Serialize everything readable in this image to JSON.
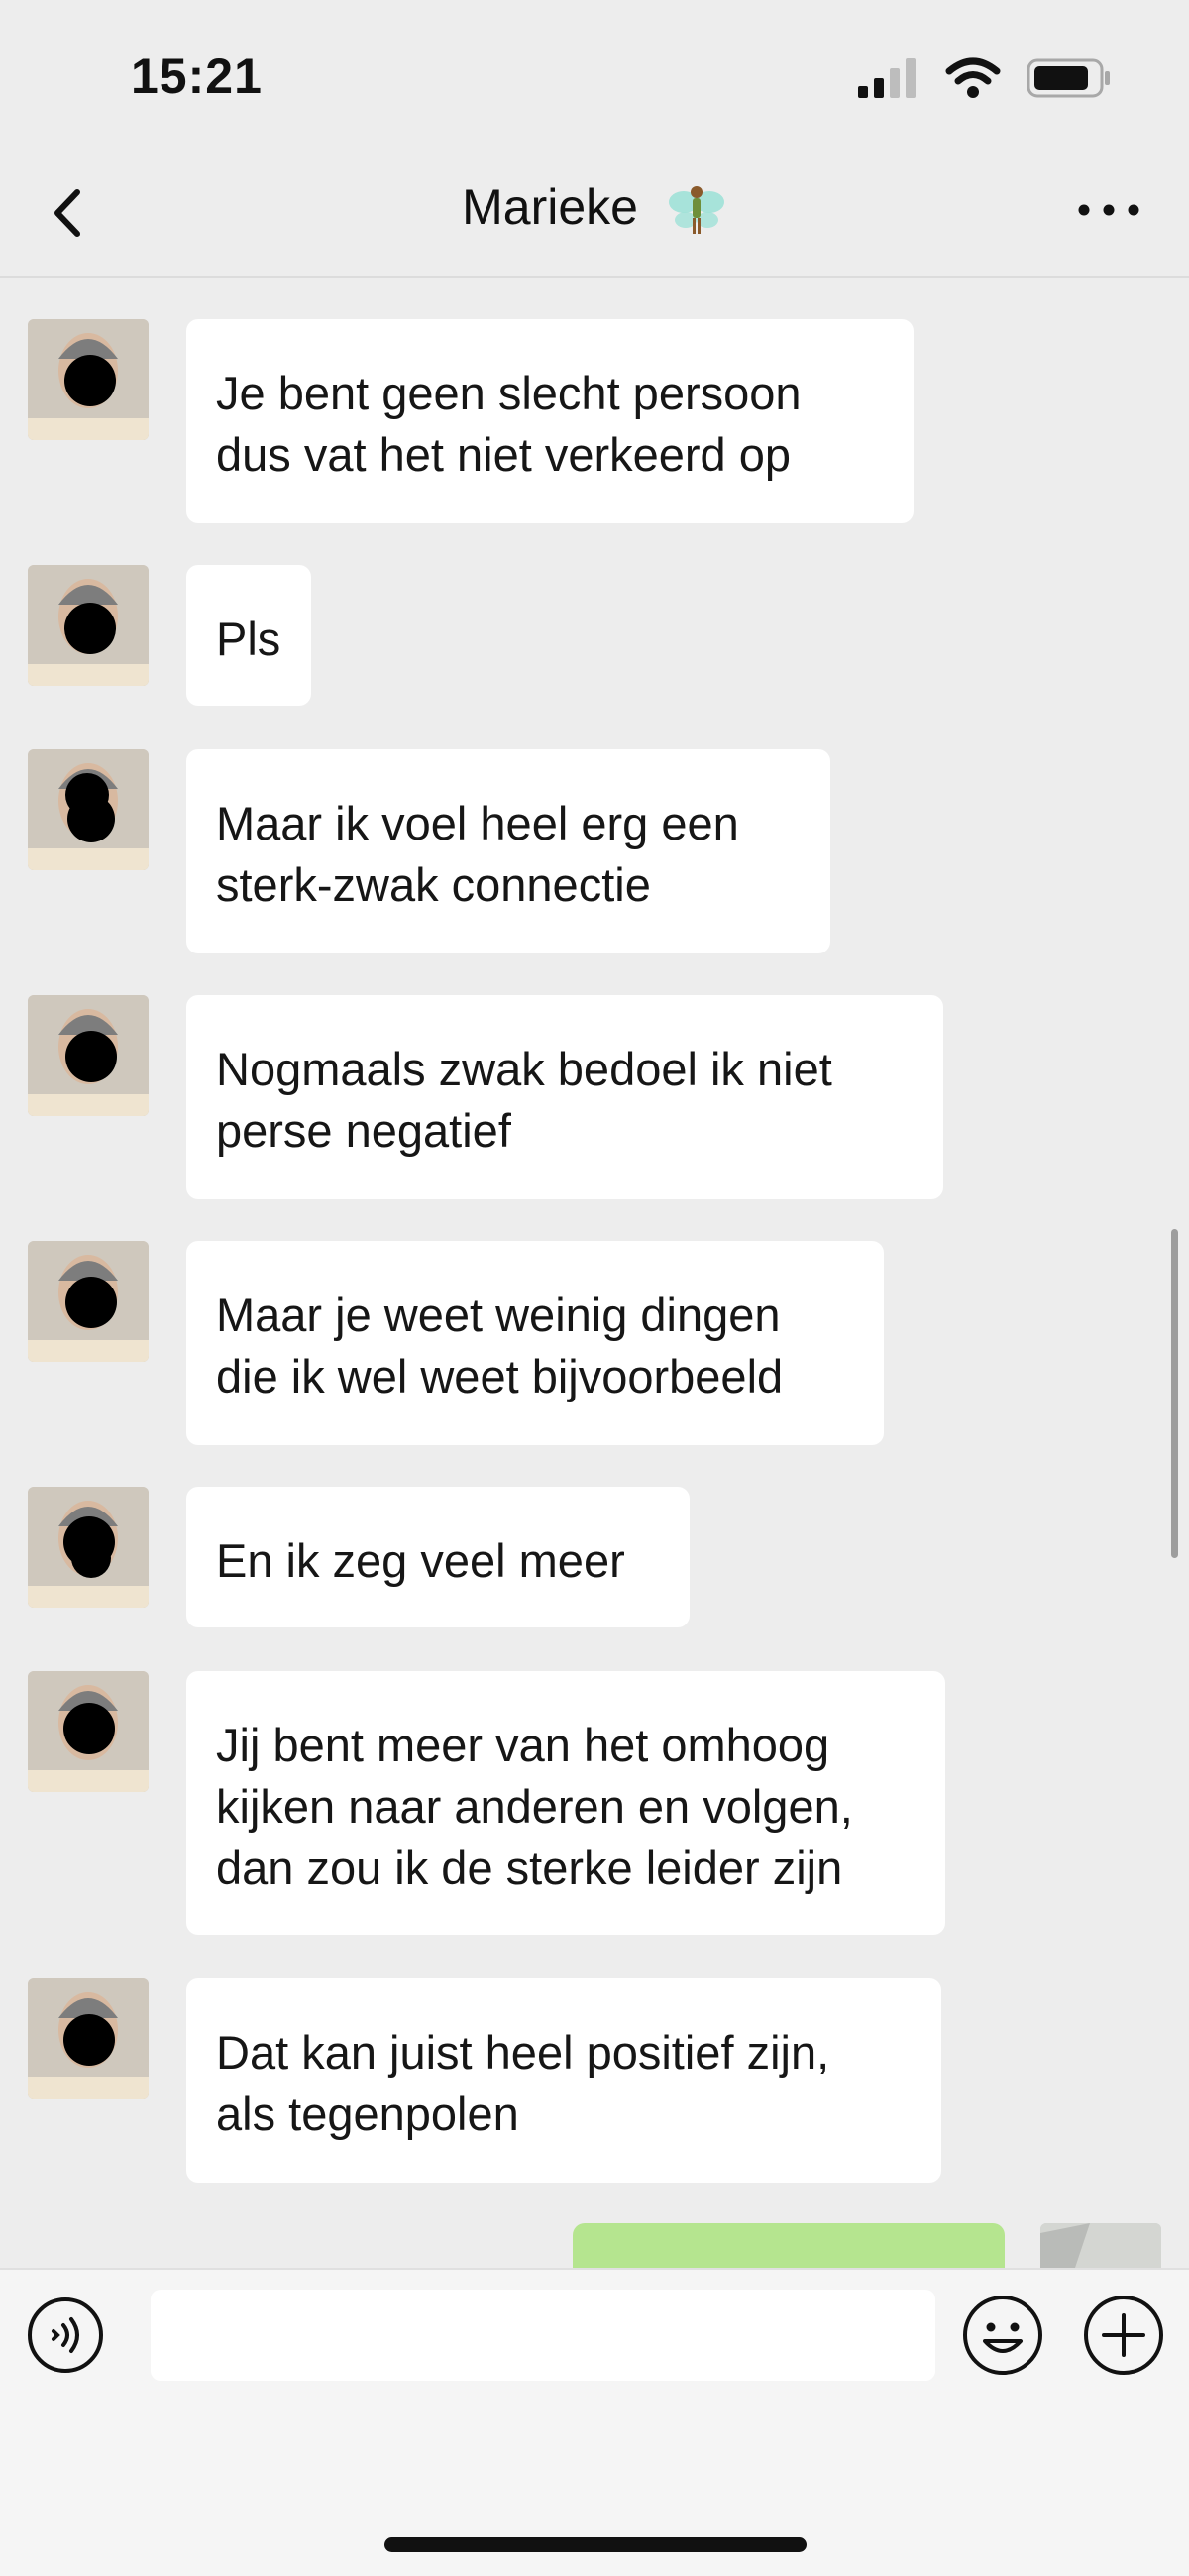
{
  "status": {
    "time": "15:21"
  },
  "header": {
    "title": "Marieke",
    "title_emoji": "fairy-icon"
  },
  "messages": [
    {
      "text": "Je bent geen slecht persoon\ndus vat het niet verkeerd op",
      "direction": "incoming"
    },
    {
      "text": "Pls",
      "direction": "incoming"
    },
    {
      "text": "Maar ik voel heel erg een\nsterk-zwak connectie",
      "direction": "incoming"
    },
    {
      "text": "Nogmaals zwak bedoel ik niet\nperse negatief",
      "direction": "incoming"
    },
    {
      "text": "Maar je weet weinig dingen\ndie ik wel weet bijvoorbeeld",
      "direction": "incoming"
    },
    {
      "text": "En ik zeg veel meer",
      "direction": "incoming"
    },
    {
      "text": "Jij bent meer van het omhoog\nkijken naar anderen en volgen,\ndan zou ik de sterke leider zijn",
      "direction": "incoming"
    },
    {
      "text": "Dat kan juist heel positief zijn,\nals tegenpolen",
      "direction": "incoming"
    }
  ],
  "input": {
    "value": "",
    "placeholder": ""
  },
  "icons": {
    "back": "chevron-left-icon",
    "more": "more-icon",
    "voice": "voice-icon",
    "emoji": "emoji-icon",
    "plus": "plus-icon"
  },
  "colors": {
    "background": "#ededed",
    "incoming_bubble": "#ffffff",
    "outgoing_bubble": "#b5e58f"
  }
}
